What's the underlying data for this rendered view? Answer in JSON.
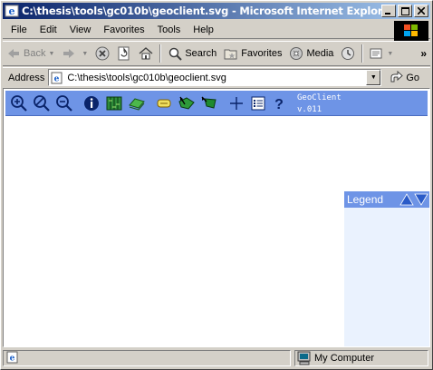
{
  "window": {
    "title": "C:\\thesis\\tools\\gc010b\\geoclient.svg - Microsoft Internet Explorer",
    "minimize": "_",
    "maximize": "□",
    "close": "×"
  },
  "menu": [
    "File",
    "Edit",
    "View",
    "Favorites",
    "Tools",
    "Help"
  ],
  "toolbar": {
    "back_label": "Back",
    "search_label": "Search",
    "favorites_label": "Favorites",
    "media_label": "Media"
  },
  "address": {
    "label": "Address",
    "value": "C:\\thesis\\tools\\gc010b\\geoclient.svg",
    "go_label": "Go"
  },
  "geoclient": {
    "title_line1": "GeoClient",
    "title_line2": "v.011",
    "tools": [
      "zoom-in",
      "zoom-reset",
      "zoom-out",
      "info",
      "layers",
      "map-layer",
      "label",
      "select-area",
      "select-feature",
      "pan-crosshair",
      "list",
      "help"
    ],
    "accent_color": "#6e94e6"
  },
  "legend": {
    "title": "Legend"
  },
  "status": {
    "zone_label": "My Computer"
  }
}
